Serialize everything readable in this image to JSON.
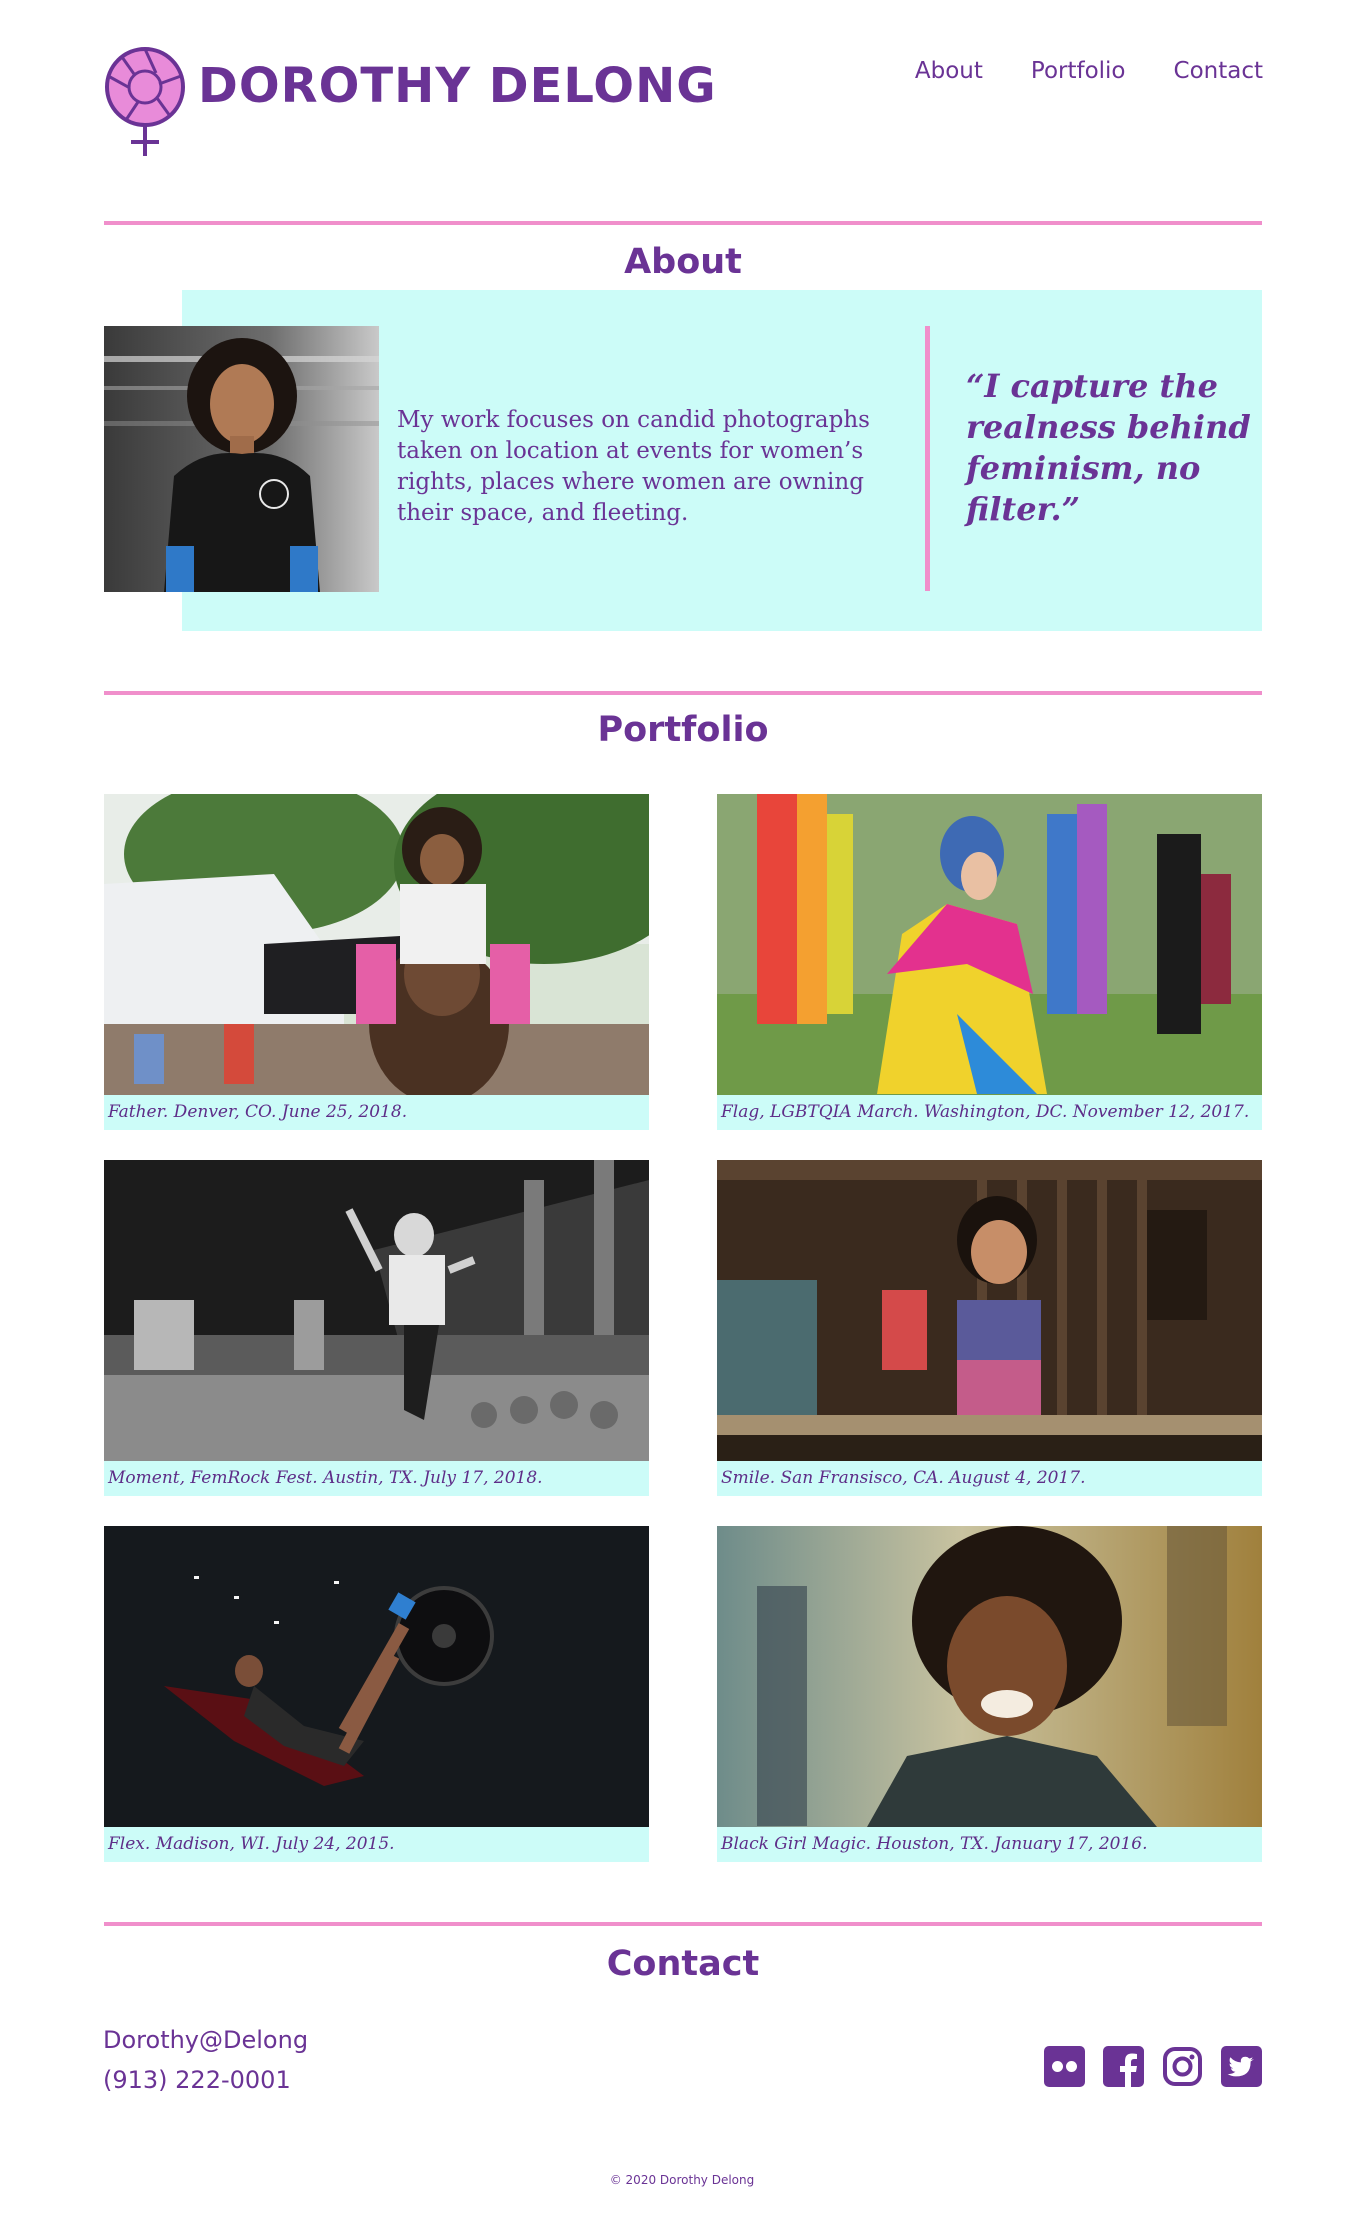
{
  "header": {
    "brand": "DOROTHY DELONG",
    "logo_icon": "venus-aperture-icon",
    "nav": [
      {
        "label": "About"
      },
      {
        "label": "Portfolio"
      },
      {
        "label": "Contact"
      }
    ]
  },
  "about": {
    "title": "About",
    "bio": "My work focuses on candid photographs taken on location at events for women’s rights, places where women are owning their space, and fleeting.",
    "quote": "“I capture the realness behind feminism, no filter.”"
  },
  "portfolio": {
    "title": "Portfolio",
    "items": [
      {
        "caption": "Father. Denver, CO. June 25, 2018."
      },
      {
        "caption": "Flag, LGBTQIA March. Washington, DC. November 12, 2017."
      },
      {
        "caption": "Moment, FemRock Fest. Austin, TX. July 17, 2018."
      },
      {
        "caption": "Smile. San Fransisco, CA. August 4, 2017."
      },
      {
        "caption": "Flex. Madison, WI. July 24, 2015."
      },
      {
        "caption": "Black Girl Magic. Houston, TX. January 17, 2016."
      }
    ]
  },
  "contact": {
    "title": "Contact",
    "email": "Dorothy@Delong",
    "phone": "(913) 222-0001",
    "socials": [
      "flickr-icon",
      "facebook-icon",
      "instagram-icon",
      "twitter-icon"
    ]
  },
  "footer": {
    "copyright": "© 2020 Dorothy Delong"
  },
  "colors": {
    "brand_purple": "#6a3395",
    "accent_pink": "#f08fcb",
    "panel_cyan": "#ccfcf8",
    "logo_pink": "#e88bd9"
  }
}
